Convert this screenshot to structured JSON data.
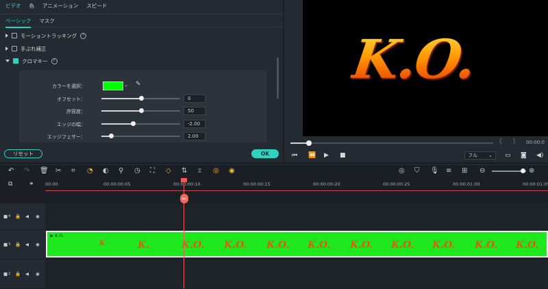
{
  "tabs": {
    "video": "ビデオ",
    "color": "色",
    "animation": "アニメーション",
    "speed": "スピード"
  },
  "subtabs": {
    "basic": "ベーシック",
    "mask": "マスク"
  },
  "sections": [
    {
      "label": "モーショントラッキング",
      "checked": false
    },
    {
      "label": "手ぶれ補正",
      "checked": false
    },
    {
      "label": "クロマキー",
      "checked": true
    }
  ],
  "chroma": {
    "color_label": "カラーを選択：",
    "color": "#00ff00",
    "rows": [
      {
        "label": "オフセット：",
        "value": "0",
        "fraction": 0.5
      },
      {
        "label": "許容度：",
        "value": "50",
        "fraction": 0.5
      },
      {
        "label": "エッジの幅：",
        "value": "-2.00",
        "fraction": 0.4
      },
      {
        "label": "エッジフェザー：",
        "value": "2.00",
        "fraction": 0.12
      }
    ]
  },
  "buttons": {
    "reset": "リセット",
    "ok": "OK"
  },
  "preview": {
    "overlay_text": "K.O.",
    "timecode": "00:00:0",
    "quality": "フル",
    "progress": 0.09
  },
  "ruler": [
    "00:00",
    "00:00:00:05",
    "00:00:00:10",
    "00:00:00:15",
    "00:00:00:20",
    "00:00:00:25",
    "00:00:01:00",
    "00:00:01:05"
  ],
  "tracks": {
    "track4": "4",
    "track3": "3",
    "track2": "2",
    "clip_name": "K.O.",
    "thumbs": [
      "K",
      "K.",
      "K.O.",
      "K.O.",
      "K.O.",
      "K.O.",
      "K.O.",
      "K.O.",
      "K.O.",
      "K.O.",
      "K.O."
    ]
  },
  "colors": {
    "accent": "#2fd3bd",
    "playhead": "#ef5b5b",
    "clip": "#1fe81f"
  }
}
